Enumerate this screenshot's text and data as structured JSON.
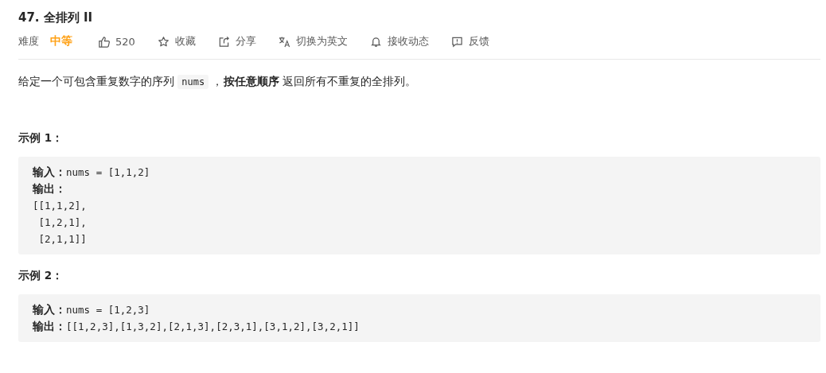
{
  "title": "47. 全排列 II",
  "meta": {
    "difficulty_label": "难度",
    "difficulty": {
      "text": "中等",
      "color": "#ffa116"
    },
    "actions": [
      {
        "kind": "like",
        "label": "520"
      },
      {
        "kind": "star",
        "label": "收藏"
      },
      {
        "kind": "share",
        "label": "分享"
      },
      {
        "kind": "translate",
        "label": "切换为英文"
      },
      {
        "kind": "bell",
        "label": "接收动态"
      },
      {
        "kind": "feedback",
        "label": "反馈"
      }
    ]
  },
  "description": [
    {
      "kind": "text",
      "text": "给定一个可包含重复数字的序列 "
    },
    {
      "kind": "code",
      "text": "nums"
    },
    {
      "kind": "text",
      "text": " ，**按任意顺序** 返回所有不重复的全排列。"
    }
  ],
  "examples": [
    {
      "heading": "示例 1：",
      "lines": [
        {
          "label": "输入：",
          "code": "nums = [1,1,2]"
        },
        {
          "label": "输出："
        },
        {
          "code": "[[1,1,2],"
        },
        {
          "code": " [1,2,1],"
        },
        {
          "code": " [2,1,1]]"
        }
      ]
    },
    {
      "heading": "示例 2：",
      "lines": [
        {
          "label": "输入：",
          "code": "nums = [1,2,3]"
        },
        {
          "label": "输出：",
          "code": "[[1,2,3],[1,3,2],[2,1,3],[2,3,1],[3,1,2],[3,2,1]]"
        }
      ]
    }
  ]
}
